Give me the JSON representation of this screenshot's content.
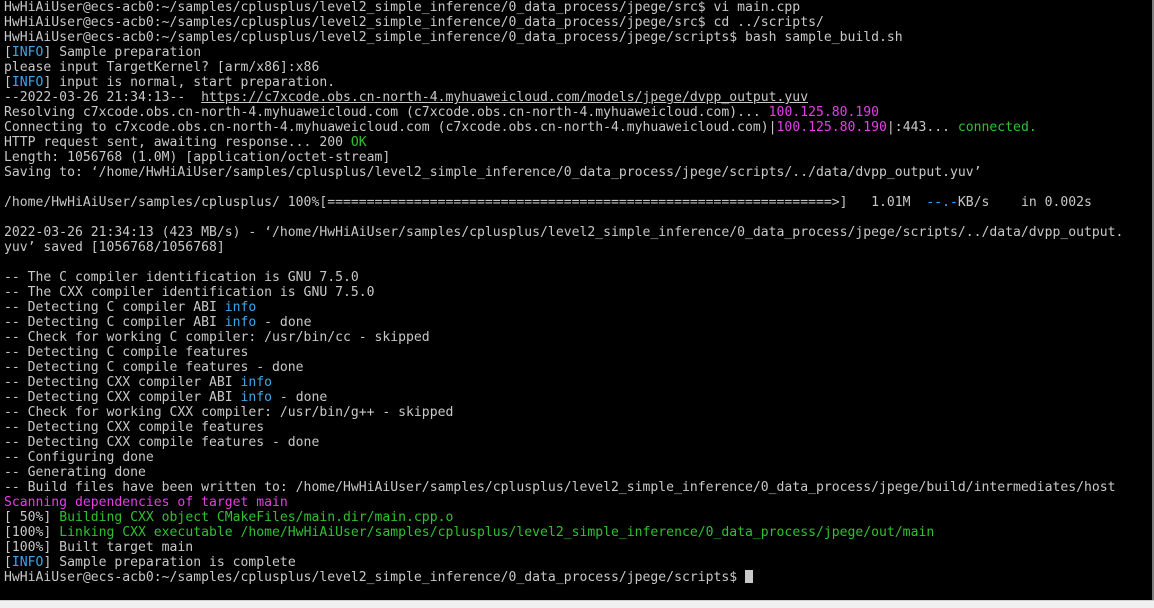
{
  "colors": {
    "background": "#000000",
    "text": "#c8c8c8",
    "green": "#2fc12f",
    "magenta": "#e63ee6",
    "blue": "#3ea6e6"
  },
  "terminal": {
    "lines": [
      [
        {
          "t": "HwHiAiUser@ecs-acb0:~/samples/cplusplus/level2_simple_inference/0_data_process/jpege/src$ vi main.cpp"
        }
      ],
      [
        {
          "t": "HwHiAiUser@ecs-acb0:~/samples/cplusplus/level2_simple_inference/0_data_process/jpege/src$ cd ../scripts/"
        }
      ],
      [
        {
          "t": "HwHiAiUser@ecs-acb0:~/samples/cplusplus/level2_simple_inference/0_data_process/jpege/scripts$ bash sample_build.sh"
        }
      ],
      [
        {
          "t": "["
        },
        {
          "t": "INFO",
          "c": "blue"
        },
        {
          "t": "] Sample preparation"
        }
      ],
      [
        {
          "t": "please input TargetKernel? [arm/x86]:x86"
        }
      ],
      [
        {
          "t": "["
        },
        {
          "t": "INFO",
          "c": "blue"
        },
        {
          "t": "] input is normal, start preparation."
        }
      ],
      [
        {
          "t": "--2022-03-26 21:34:13--  "
        },
        {
          "t": "https://c7xcode.obs.cn-north-4.myhuaweicloud.com/models/jpege/dvpp_output.yuv",
          "c": "link"
        }
      ],
      [
        {
          "t": "Resolving c7xcode.obs.cn-north-4.myhuaweicloud.com (c7xcode.obs.cn-north-4.myhuaweicloud.com)... "
        },
        {
          "t": "100.125.80.190",
          "c": "magenta"
        }
      ],
      [
        {
          "t": "Connecting to c7xcode.obs.cn-north-4.myhuaweicloud.com (c7xcode.obs.cn-north-4.myhuaweicloud.com)|"
        },
        {
          "t": "100.125.80.190",
          "c": "magenta"
        },
        {
          "t": "|:443... "
        },
        {
          "t": "connected.",
          "c": "green"
        }
      ],
      [
        {
          "t": "HTTP request sent, awaiting response... 200 "
        },
        {
          "t": "OK",
          "c": "green"
        }
      ],
      [
        {
          "t": "Length: 1056768 (1.0M) [application/octet-stream]"
        }
      ],
      [
        {
          "t": "Saving to: ‘/home/HwHiAiUser/samples/cplusplus/level2_simple_inference/0_data_process/jpege/scripts/../data/dvpp_output.yuv’"
        }
      ],
      [
        {
          "t": ""
        }
      ],
      [
        {
          "t": "/home/HwHiAiUser/samples/cplusplus/ 100%[================================================================>]   1.01M  "
        },
        {
          "t": "--.-",
          "c": "blue"
        },
        {
          "t": "KB/s    in 0.002s"
        }
      ],
      [
        {
          "t": ""
        }
      ],
      [
        {
          "t": "2022-03-26 21:34:13 (423 MB/s) - ‘/home/HwHiAiUser/samples/cplusplus/level2_simple_inference/0_data_process/jpege/scripts/../data/dvpp_output."
        }
      ],
      [
        {
          "t": "yuv’ saved [1056768/1056768]"
        }
      ],
      [
        {
          "t": ""
        }
      ],
      [
        {
          "t": "-- The C compiler identification is GNU 7.5.0"
        }
      ],
      [
        {
          "t": "-- The CXX compiler identification is GNU 7.5.0"
        }
      ],
      [
        {
          "t": "-- Detecting C compiler ABI "
        },
        {
          "t": "info",
          "c": "blue"
        }
      ],
      [
        {
          "t": "-- Detecting C compiler ABI "
        },
        {
          "t": "info",
          "c": "blue"
        },
        {
          "t": " - done"
        }
      ],
      [
        {
          "t": "-- Check for working C compiler: /usr/bin/cc - skipped"
        }
      ],
      [
        {
          "t": "-- Detecting C compile features"
        }
      ],
      [
        {
          "t": "-- Detecting C compile features - done"
        }
      ],
      [
        {
          "t": "-- Detecting CXX compiler ABI "
        },
        {
          "t": "info",
          "c": "blue"
        }
      ],
      [
        {
          "t": "-- Detecting CXX compiler ABI "
        },
        {
          "t": "info",
          "c": "blue"
        },
        {
          "t": " - done"
        }
      ],
      [
        {
          "t": "-- Check for working CXX compiler: /usr/bin/g++ - skipped"
        }
      ],
      [
        {
          "t": "-- Detecting CXX compile features"
        }
      ],
      [
        {
          "t": "-- Detecting CXX compile features - done"
        }
      ],
      [
        {
          "t": "-- Configuring done"
        }
      ],
      [
        {
          "t": "-- Generating done"
        }
      ],
      [
        {
          "t": "-- Build files have been written to: /home/HwHiAiUser/samples/cplusplus/level2_simple_inference/0_data_process/jpege/build/intermediates/host"
        }
      ],
      [
        {
          "t": "Scanning dependencies of target main",
          "c": "magenta"
        }
      ],
      [
        {
          "t": "[ 50%] "
        },
        {
          "t": "Building CXX object CMakeFiles/main.dir/main.cpp.o",
          "c": "green"
        }
      ],
      [
        {
          "t": "[100%] "
        },
        {
          "t": "Linking CXX executable /home/HwHiAiUser/samples/cplusplus/level2_simple_inference/0_data_process/jpege/out/main",
          "c": "green"
        }
      ],
      [
        {
          "t": "[100%] Built target main"
        }
      ],
      [
        {
          "t": "["
        },
        {
          "t": "INFO",
          "c": "blue"
        },
        {
          "t": "] Sample preparation is complete"
        }
      ],
      [
        {
          "t": "HwHiAiUser@ecs-acb0:~/samples/cplusplus/level2_simple_inference/0_data_process/jpege/scripts$ "
        },
        {
          "cursor": true
        }
      ]
    ]
  }
}
